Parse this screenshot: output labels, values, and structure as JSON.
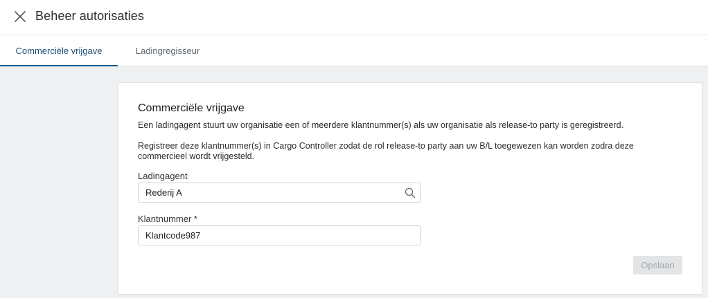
{
  "header": {
    "title": "Beheer autorisaties",
    "close_icon": "close-icon"
  },
  "tabs": [
    {
      "label": "Commerciële vrijgave",
      "active": true
    },
    {
      "label": "Ladingregisseur",
      "active": false
    }
  ],
  "card": {
    "title": "Commerciële vrijgave",
    "description_1": "Een ladingagent stuurt uw organisatie een of meerdere klantnummer(s) als uw organisatie als release-to party is geregistreerd.",
    "description_2_line1": "Registreer deze klantnummer(s) in Cargo Controller zodat de rol release-to party aan uw B/L toegewezen kan worden zodra deze",
    "description_2_line2": "commercieel wordt vrijgesteld.",
    "fields": {
      "ladingagent": {
        "label": "Ladingagent",
        "value": "Rederij A",
        "icon": "search-icon"
      },
      "klantnummer": {
        "label": "Klantnummer *",
        "value": "Klantcode987"
      }
    },
    "save_label": "Opslaan",
    "save_disabled": true
  },
  "colors": {
    "accent": "#1e5a8a",
    "background": "#eef0f2",
    "disabled_button_bg": "#e2e4e6",
    "disabled_button_text": "#a4a8ac"
  }
}
